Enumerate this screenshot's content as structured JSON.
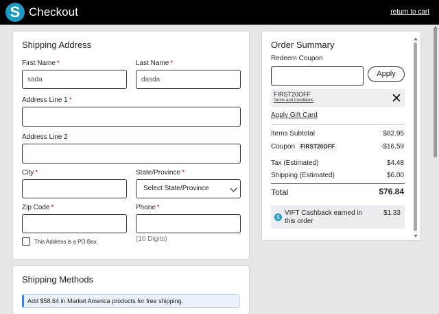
{
  "header": {
    "logo_letter": "S",
    "title": "Checkout",
    "return_link": "return to cart"
  },
  "shipping_address": {
    "title": "Shipping Address",
    "first_name": {
      "label": "First Name",
      "value": "sada"
    },
    "last_name": {
      "label": "Last Name",
      "value": "dasda"
    },
    "address1": {
      "label": "Address Line 1",
      "value": ""
    },
    "address2": {
      "label": "Address Line 2",
      "value": ""
    },
    "city": {
      "label": "City",
      "value": ""
    },
    "state": {
      "label": "State/Province",
      "selected": "Select State/Province"
    },
    "zip": {
      "label": "Zip Code",
      "value": ""
    },
    "phone": {
      "label": "Phone",
      "value": "",
      "hint": "(10 Digits)"
    },
    "po_box_label": "This Address is a PO Box",
    "required_mark": "*"
  },
  "shipping_methods": {
    "title": "Shipping Methods",
    "notice": "Add $58.64 in Market America products for free shipping."
  },
  "order_summary": {
    "title": "Order Summary",
    "redeem_label": "Redeem Coupon",
    "coupon_input": "",
    "apply_label": "Apply",
    "applied_coupon": {
      "code": "FIRST20OFF",
      "terms": "Terms and Conditions"
    },
    "gift_card_link": "Apply Gift Card",
    "items_subtotal": {
      "label": "Items Subtotal",
      "value": "$82.95"
    },
    "coupon": {
      "label": "Coupon",
      "code": "FIRST20OFF",
      "value": "-$16.59"
    },
    "tax": {
      "label": "Tax (Estimated)",
      "value": "$4.48"
    },
    "shipping": {
      "label": "Shipping (Estimated)",
      "value": "$6.00"
    },
    "total": {
      "label": "Total",
      "value": "$76.84"
    },
    "cashback": {
      "icon_glyph": "$",
      "text": "VIFT Cashback earned in this order",
      "value": "$1.33"
    }
  },
  "colors": {
    "header_bg": "#000000",
    "logo_accent": "#1a9bc4",
    "required": "#d0021b",
    "notice_accent": "#3b82f6"
  }
}
